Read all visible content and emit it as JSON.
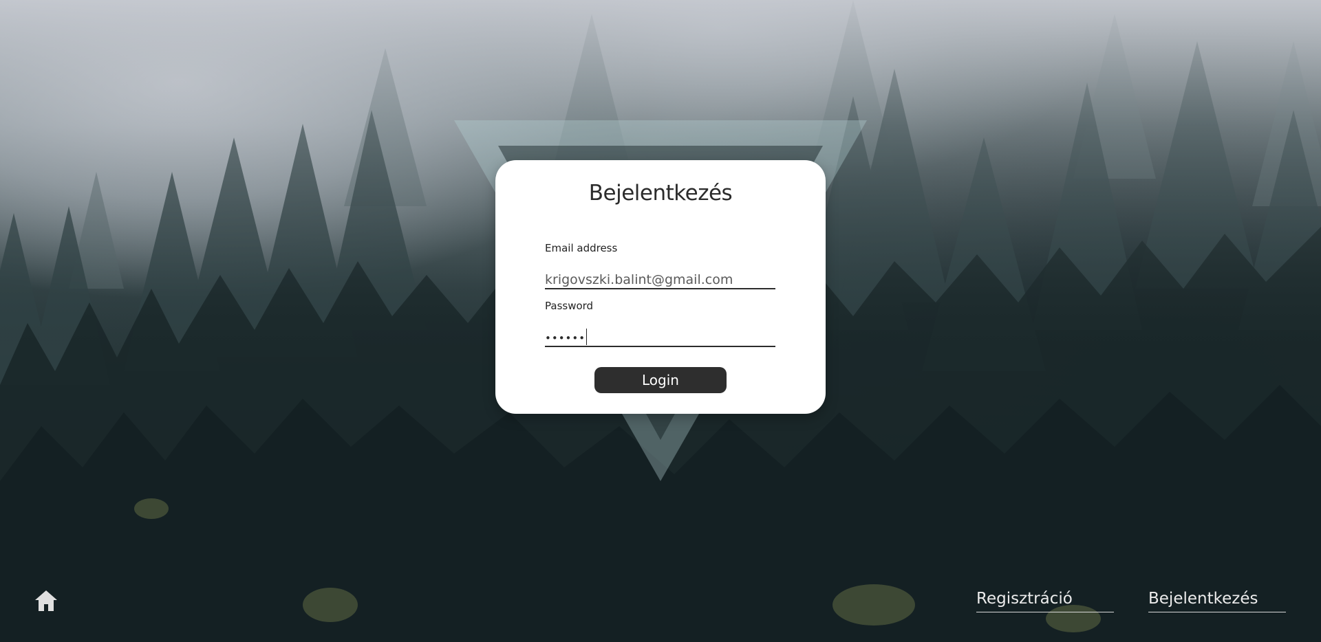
{
  "card": {
    "title": "Bejelentkezés",
    "email_label": "Email address",
    "email_value": "krigovszki.balint@gmail.com",
    "password_label": "Password",
    "password_value": "••••••",
    "login_label": "Login"
  },
  "nav": {
    "register_label": "Regisztráció",
    "login_label": "Bejelentkezés"
  },
  "icons": {
    "home": "home-icon"
  },
  "colors": {
    "card_bg": "#ffffff",
    "button_bg": "#2e2e2e",
    "text_dark": "#2b2b2b",
    "nav_text": "#ececec"
  }
}
